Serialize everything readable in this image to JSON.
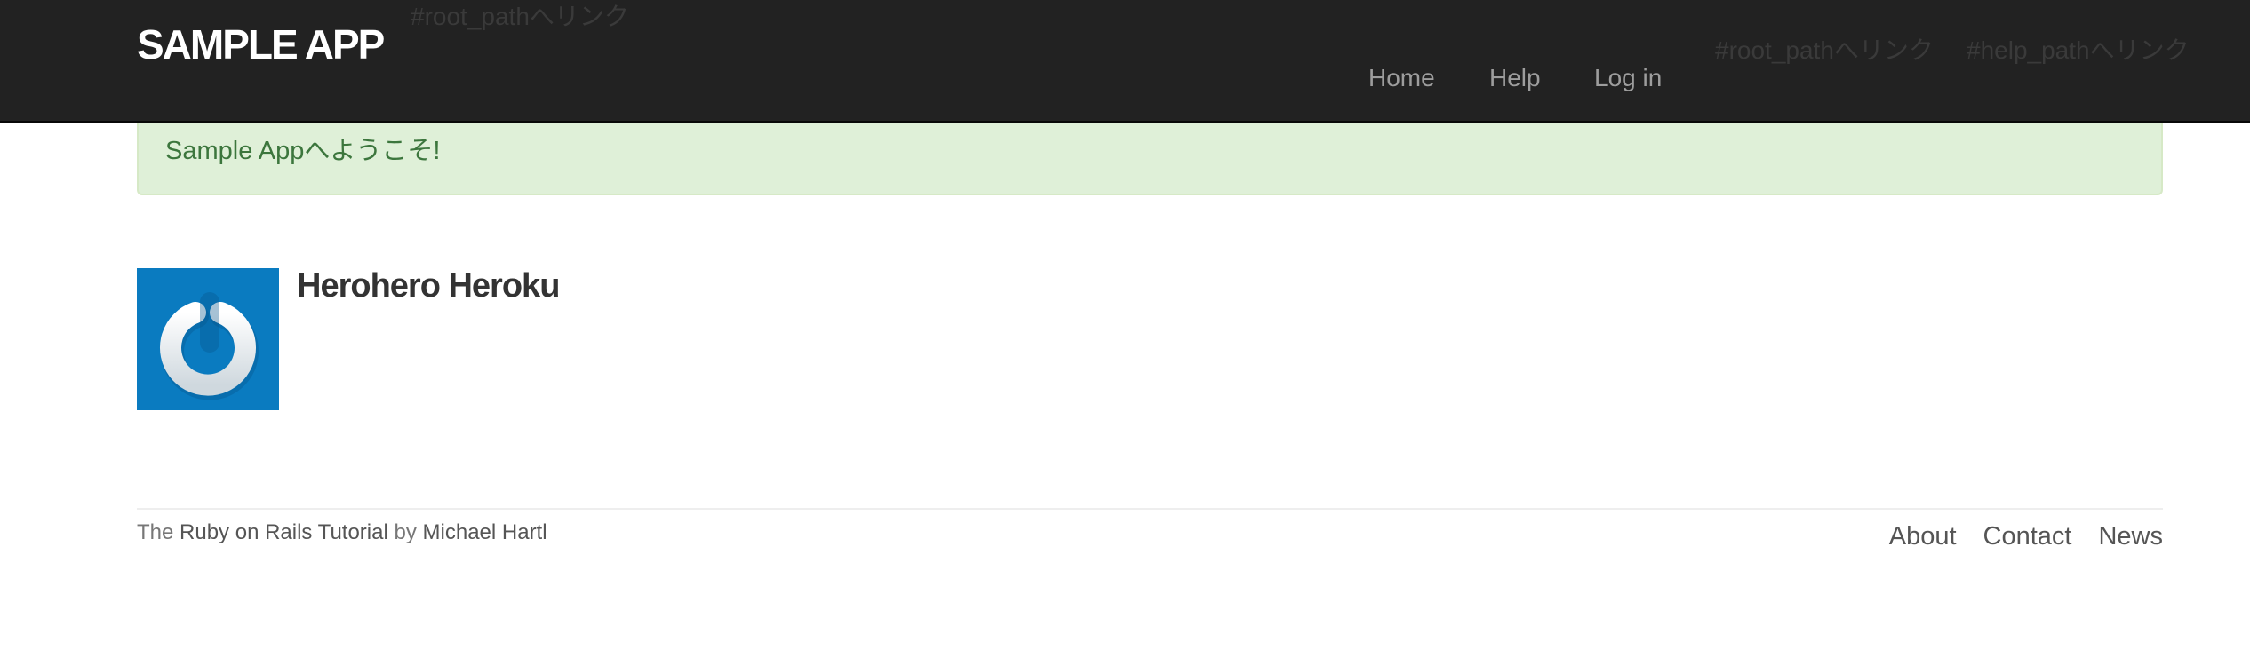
{
  "header": {
    "logo": "SAMPLE APP",
    "debug_root_1": "#root_pathへリンク",
    "debug_root_2": "#root_pathへリンク",
    "debug_help": "#help_pathへリンク",
    "nav": {
      "home": "Home",
      "help": "Help",
      "login": "Log in"
    }
  },
  "flash": {
    "message": "Sample Appへようこそ!"
  },
  "user": {
    "name": "Herohero Heroku",
    "avatar_icon": "gravatar-power-icon",
    "avatar_color": "#0a7bc0"
  },
  "footer": {
    "credit_the": "The",
    "credit_link_tutorial": "Ruby on Rails Tutorial",
    "credit_by": "by",
    "credit_link_author": "Michael Hartl",
    "links": {
      "about": "About",
      "contact": "Contact",
      "news": "News"
    }
  },
  "colors": {
    "navbar_bg": "#222222",
    "alert_bg": "#dff0d8",
    "alert_text": "#3c763d"
  }
}
